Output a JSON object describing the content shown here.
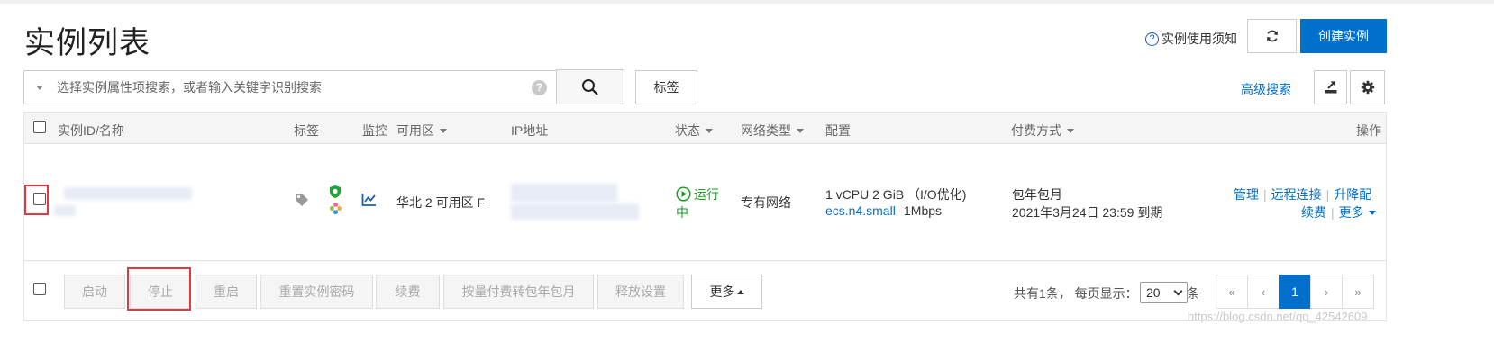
{
  "page": {
    "title": "实例列表"
  },
  "top_actions": {
    "notice_label": "实例使用须知",
    "create_label": "创建实例"
  },
  "search": {
    "placeholder": "选择实例属性项搜索，或者输入关键字识别搜索",
    "tag_label": "标签",
    "advanced_label": "高级搜索"
  },
  "table": {
    "headers": {
      "id_name": "实例ID/名称",
      "tags": "标签",
      "monitor": "监控",
      "zone": "可用区",
      "ip": "IP地址",
      "status": "状态",
      "network": "网络类型",
      "config": "配置",
      "billing": "付费方式",
      "actions": "操作"
    },
    "rows": [
      {
        "zone": "华北 2 可用区 F",
        "status_line1": "运行",
        "status_line2": "中",
        "network": "专有网络",
        "config_line1": "1 vCPU 2 GiB （I/O优化)",
        "instance_type": "ecs.n4.small",
        "bandwidth": "1Mbps",
        "billing_line1": "包年包月",
        "billing_line2": "2021年3月24日 23:59 到期",
        "actions": {
          "manage": "管理",
          "remote": "远程连接",
          "resize": "升降配",
          "renew": "续费",
          "more": "更多"
        }
      }
    ]
  },
  "footer": {
    "buttons": [
      "启动",
      "停止",
      "重启",
      "重置实例密码",
      "续费",
      "按量付费转包年包月",
      "释放设置"
    ],
    "more_label": "更多",
    "total_text": "共有1条， 每页显示：",
    "page_size": "20",
    "page_size_suffix": "条",
    "pager": {
      "first": "«",
      "prev": "‹",
      "current": "1",
      "next": "›",
      "last": "»"
    }
  },
  "watermark": "https://blog.csdn.net/qq_42542609",
  "colors": {
    "primary": "#0070cc",
    "running": "#1a9e24",
    "highlight": "#e0393e"
  }
}
